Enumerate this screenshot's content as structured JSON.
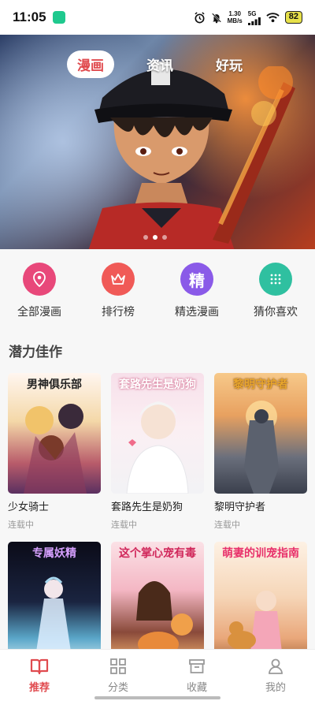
{
  "status_bar": {
    "time": "11:05",
    "net_speed_value": "1.30",
    "net_speed_unit": "MB/s",
    "signal_label": "5G",
    "battery": "82"
  },
  "banner": {
    "tabs": [
      {
        "label": "漫画",
        "active": true
      },
      {
        "label": "资讯",
        "active": false
      },
      {
        "label": "好玩",
        "active": false
      }
    ],
    "dots_total": 3,
    "dots_active_index": 1
  },
  "quick_nav": [
    {
      "label": "全部漫画",
      "icon": "location-pin-icon",
      "color": "#e8487a"
    },
    {
      "label": "排行榜",
      "icon": "crown-icon",
      "color": "#f05a57"
    },
    {
      "label": "精选漫画",
      "icon": "jing-icon",
      "glyph": "精",
      "color": "#8a5ae8"
    },
    {
      "label": "猜你喜欢",
      "icon": "dot-grid-icon",
      "color": "#2fc0a0"
    }
  ],
  "section": {
    "title": "潜力佳作"
  },
  "comics": [
    {
      "name": "少女骑士",
      "status": "连载中",
      "cover_title": "男神俱乐部",
      "title_color": "#222",
      "bg": "linear-gradient(180deg,#fff6f0 0%,#f4d8a8 40%,#b85b6a 75%,#5a3060 100%)"
    },
    {
      "name": "套路先生是奶狗",
      "status": "连载中",
      "cover_title": "套路先生是奶狗",
      "title_color": "#ffffff",
      "bg": "linear-gradient(180deg,#f7e0ea 0%,#fbeff3 45%,#f2f2f5 100%)"
    },
    {
      "name": "黎明守护者",
      "status": "连载中",
      "cover_title": "黎明守护者",
      "title_color": "#e9a62c",
      "bg": "linear-gradient(180deg,#f7c98a 0%,#e8a160 35%,#6a6f7c 70%,#3a3f4c 100%)"
    },
    {
      "name": "",
      "status": "",
      "cover_title": "专属妖精",
      "title_color": "#d6a0ff",
      "bg": "linear-gradient(180deg,#0b0b18 0%,#1a2440 50%,#5aa6c8 80%,#c8e6f0 100%)"
    },
    {
      "name": "",
      "status": "",
      "cover_title": "这个掌心宠有毒",
      "title_color": "#d0265a",
      "bg": "linear-gradient(180deg,#fbe1e6 0%,#f4b7c4 40%,#8a4a3a 75%,#f0b070 100%)"
    },
    {
      "name": "",
      "status": "",
      "cover_title": "萌妻的训宠指南",
      "title_color": "#e8306a",
      "bg": "linear-gradient(180deg,#fdf1e4 0%,#f6d6b8 45%,#e9a77a 80%,#a86a3c 100%)"
    }
  ],
  "bottom_nav": [
    {
      "label": "推荐",
      "icon": "book-open-icon",
      "active": true
    },
    {
      "label": "分类",
      "icon": "grid-icon",
      "active": false
    },
    {
      "label": "收藏",
      "icon": "archive-box-icon",
      "active": false
    },
    {
      "label": "我的",
      "icon": "user-icon",
      "active": false
    }
  ]
}
